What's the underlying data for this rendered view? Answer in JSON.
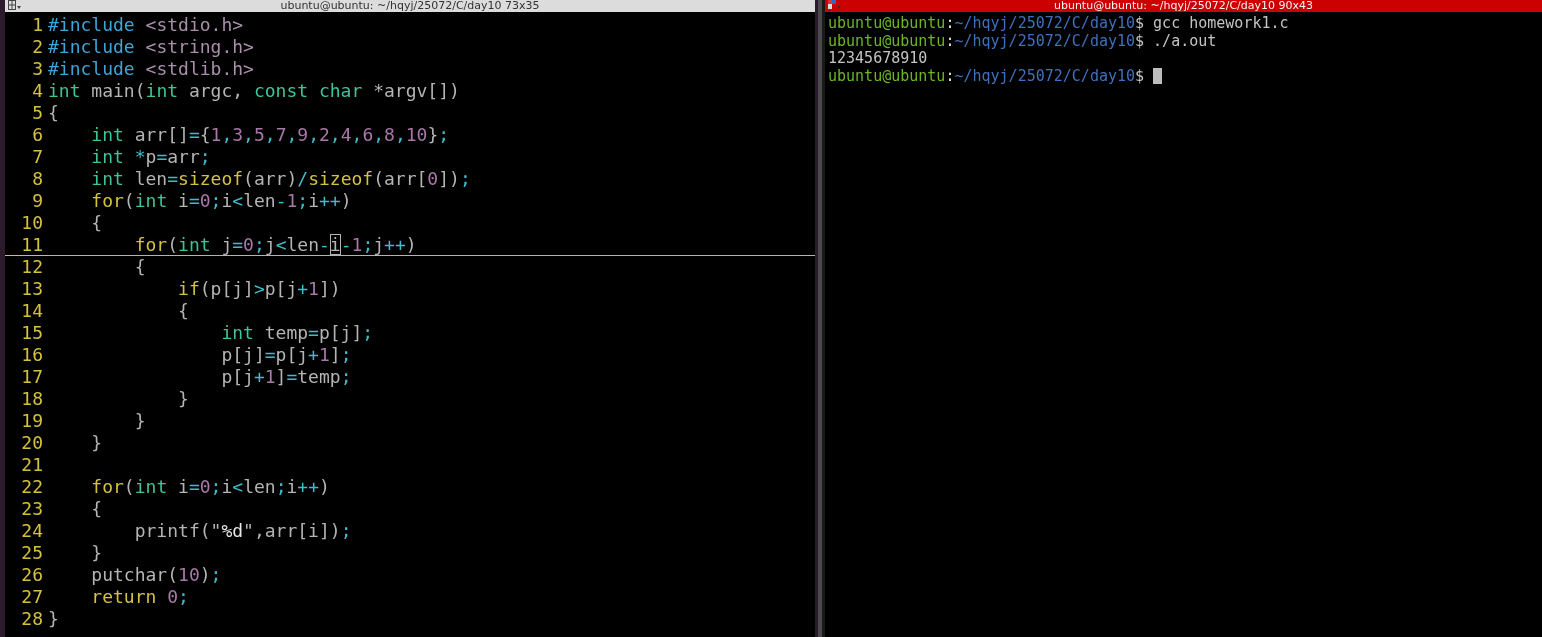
{
  "editor": {
    "title": "ubuntu@ubuntu: ~/hqyj/25072/C/day10 73x35",
    "lines": [
      {
        "number": "1",
        "current": false,
        "tokens": [
          {
            "kind": "pp",
            "text": "#include"
          },
          {
            "kind": "inc",
            "text": " <stdio.h>"
          }
        ]
      },
      {
        "number": "2",
        "current": false,
        "tokens": [
          {
            "kind": "pp",
            "text": "#include"
          },
          {
            "kind": "inc",
            "text": " <string.h>"
          }
        ]
      },
      {
        "number": "3",
        "current": false,
        "tokens": [
          {
            "kind": "pp",
            "text": "#include"
          },
          {
            "kind": "inc",
            "text": " <stdlib.h>"
          }
        ]
      },
      {
        "number": "4",
        "current": false,
        "tokens": [
          {
            "kind": "type",
            "text": "int"
          },
          {
            "kind": "plain",
            "text": " main("
          },
          {
            "kind": "type",
            "text": "int"
          },
          {
            "kind": "plain",
            "text": " argc, "
          },
          {
            "kind": "type",
            "text": "const"
          },
          {
            "kind": "type",
            "text": " char"
          },
          {
            "kind": "plain",
            "text": " *argv[])"
          }
        ]
      },
      {
        "number": "5",
        "current": false,
        "tokens": [
          {
            "kind": "plain",
            "text": "{"
          }
        ]
      },
      {
        "number": "6",
        "current": false,
        "tokens": [
          {
            "kind": "type",
            "text": "    int"
          },
          {
            "kind": "plain",
            "text": " arr[]"
          },
          {
            "kind": "op",
            "text": "="
          },
          {
            "kind": "plain",
            "text": "{"
          },
          {
            "kind": "num",
            "text": "1"
          },
          {
            "kind": "op",
            "text": ","
          },
          {
            "kind": "num",
            "text": "3"
          },
          {
            "kind": "op",
            "text": ","
          },
          {
            "kind": "num",
            "text": "5"
          },
          {
            "kind": "op",
            "text": ","
          },
          {
            "kind": "num",
            "text": "7"
          },
          {
            "kind": "op",
            "text": ","
          },
          {
            "kind": "num",
            "text": "9"
          },
          {
            "kind": "op",
            "text": ","
          },
          {
            "kind": "num",
            "text": "2"
          },
          {
            "kind": "op",
            "text": ","
          },
          {
            "kind": "num",
            "text": "4"
          },
          {
            "kind": "op",
            "text": ","
          },
          {
            "kind": "num",
            "text": "6"
          },
          {
            "kind": "op",
            "text": ","
          },
          {
            "kind": "num",
            "text": "8"
          },
          {
            "kind": "op",
            "text": ","
          },
          {
            "kind": "num",
            "text": "10"
          },
          {
            "kind": "plain",
            "text": "}"
          },
          {
            "kind": "op",
            "text": ";"
          }
        ]
      },
      {
        "number": "7",
        "current": false,
        "tokens": [
          {
            "kind": "type",
            "text": "    int"
          },
          {
            "kind": "op",
            "text": " *"
          },
          {
            "kind": "plain",
            "text": "p"
          },
          {
            "kind": "op",
            "text": "="
          },
          {
            "kind": "plain",
            "text": "arr"
          },
          {
            "kind": "op",
            "text": ";"
          }
        ]
      },
      {
        "number": "8",
        "current": false,
        "tokens": [
          {
            "kind": "type",
            "text": "    int"
          },
          {
            "kind": "plain",
            "text": " len"
          },
          {
            "kind": "op",
            "text": "="
          },
          {
            "kind": "stmt",
            "text": "sizeof"
          },
          {
            "kind": "plain",
            "text": "(arr)"
          },
          {
            "kind": "op",
            "text": "/"
          },
          {
            "kind": "stmt",
            "text": "sizeof"
          },
          {
            "kind": "plain",
            "text": "(arr["
          },
          {
            "kind": "num",
            "text": "0"
          },
          {
            "kind": "plain",
            "text": "])"
          },
          {
            "kind": "op",
            "text": ";"
          }
        ]
      },
      {
        "number": "9",
        "current": false,
        "tokens": [
          {
            "kind": "stmt",
            "text": "    for"
          },
          {
            "kind": "plain",
            "text": "("
          },
          {
            "kind": "type",
            "text": "int"
          },
          {
            "kind": "plain",
            "text": " i"
          },
          {
            "kind": "op",
            "text": "="
          },
          {
            "kind": "num",
            "text": "0"
          },
          {
            "kind": "op",
            "text": ";"
          },
          {
            "kind": "plain",
            "text": "i"
          },
          {
            "kind": "op",
            "text": "<"
          },
          {
            "kind": "plain",
            "text": "len"
          },
          {
            "kind": "op",
            "text": "-"
          },
          {
            "kind": "num",
            "text": "1"
          },
          {
            "kind": "op",
            "text": ";"
          },
          {
            "kind": "plain",
            "text": "i"
          },
          {
            "kind": "op",
            "text": "++"
          },
          {
            "kind": "plain",
            "text": ")"
          }
        ]
      },
      {
        "number": "10",
        "current": false,
        "tokens": [
          {
            "kind": "plain",
            "text": "    {"
          }
        ]
      },
      {
        "number": "11",
        "current": true,
        "tokens": [
          {
            "kind": "stmt",
            "text": "        for"
          },
          {
            "kind": "plain",
            "text": "("
          },
          {
            "kind": "type",
            "text": "int"
          },
          {
            "kind": "plain",
            "text": " j"
          },
          {
            "kind": "op",
            "text": "="
          },
          {
            "kind": "num",
            "text": "0"
          },
          {
            "kind": "op",
            "text": ";"
          },
          {
            "kind": "plain",
            "text": "j"
          },
          {
            "kind": "op",
            "text": "<"
          },
          {
            "kind": "plain",
            "text": "len"
          },
          {
            "kind": "op",
            "text": "-"
          },
          {
            "kind": "cursor",
            "text": "i"
          },
          {
            "kind": "op",
            "text": "-"
          },
          {
            "kind": "num",
            "text": "1"
          },
          {
            "kind": "op",
            "text": ";"
          },
          {
            "kind": "plain",
            "text": "j"
          },
          {
            "kind": "op",
            "text": "++"
          },
          {
            "kind": "plain",
            "text": ")"
          }
        ]
      },
      {
        "number": "12",
        "current": false,
        "tokens": [
          {
            "kind": "plain",
            "text": "        {"
          }
        ]
      },
      {
        "number": "13",
        "current": false,
        "tokens": [
          {
            "kind": "stmt",
            "text": "            if"
          },
          {
            "kind": "plain",
            "text": "(p[j]"
          },
          {
            "kind": "op",
            "text": ">"
          },
          {
            "kind": "plain",
            "text": "p[j"
          },
          {
            "kind": "op",
            "text": "+"
          },
          {
            "kind": "num",
            "text": "1"
          },
          {
            "kind": "plain",
            "text": "])"
          }
        ]
      },
      {
        "number": "14",
        "current": false,
        "tokens": [
          {
            "kind": "plain",
            "text": "            {"
          }
        ]
      },
      {
        "number": "15",
        "current": false,
        "tokens": [
          {
            "kind": "type",
            "text": "                int"
          },
          {
            "kind": "plain",
            "text": " temp"
          },
          {
            "kind": "op",
            "text": "="
          },
          {
            "kind": "plain",
            "text": "p[j]"
          },
          {
            "kind": "op",
            "text": ";"
          }
        ]
      },
      {
        "number": "16",
        "current": false,
        "tokens": [
          {
            "kind": "plain",
            "text": "                p[j]"
          },
          {
            "kind": "op",
            "text": "="
          },
          {
            "kind": "plain",
            "text": "p[j"
          },
          {
            "kind": "op",
            "text": "+"
          },
          {
            "kind": "num",
            "text": "1"
          },
          {
            "kind": "plain",
            "text": "]"
          },
          {
            "kind": "op",
            "text": ";"
          }
        ]
      },
      {
        "number": "17",
        "current": false,
        "tokens": [
          {
            "kind": "plain",
            "text": "                p[j"
          },
          {
            "kind": "op",
            "text": "+"
          },
          {
            "kind": "num",
            "text": "1"
          },
          {
            "kind": "plain",
            "text": "]"
          },
          {
            "kind": "op",
            "text": "="
          },
          {
            "kind": "plain",
            "text": "temp"
          },
          {
            "kind": "op",
            "text": ";"
          }
        ]
      },
      {
        "number": "18",
        "current": false,
        "tokens": [
          {
            "kind": "plain",
            "text": "            }"
          }
        ]
      },
      {
        "number": "19",
        "current": false,
        "tokens": [
          {
            "kind": "plain",
            "text": "        }"
          }
        ]
      },
      {
        "number": "20",
        "current": false,
        "tokens": [
          {
            "kind": "plain",
            "text": "    }"
          }
        ]
      },
      {
        "number": "21",
        "current": false
      },
      {
        "number": "22",
        "current": false,
        "tokens": [
          {
            "kind": "stmt",
            "text": "    for"
          },
          {
            "kind": "plain",
            "text": "("
          },
          {
            "kind": "type",
            "text": "int"
          },
          {
            "kind": "plain",
            "text": " i"
          },
          {
            "kind": "op",
            "text": "="
          },
          {
            "kind": "num",
            "text": "0"
          },
          {
            "kind": "op",
            "text": ";"
          },
          {
            "kind": "plain",
            "text": "i"
          },
          {
            "kind": "op",
            "text": "<"
          },
          {
            "kind": "plain",
            "text": "len"
          },
          {
            "kind": "op",
            "text": ";"
          },
          {
            "kind": "plain",
            "text": "i"
          },
          {
            "kind": "op",
            "text": "++"
          },
          {
            "kind": "plain",
            "text": ")"
          }
        ]
      },
      {
        "number": "23",
        "current": false,
        "tokens": [
          {
            "kind": "plain",
            "text": "    {"
          }
        ]
      },
      {
        "number": "24",
        "current": false,
        "tokens": [
          {
            "kind": "plain",
            "text": "        printf(\""
          },
          {
            "kind": "special",
            "text": "%d"
          },
          {
            "kind": "plain",
            "text": "\",arr[i])"
          },
          {
            "kind": "op",
            "text": ";"
          }
        ]
      },
      {
        "number": "25",
        "current": false,
        "tokens": [
          {
            "kind": "plain",
            "text": "    }"
          }
        ]
      },
      {
        "number": "26",
        "current": false,
        "tokens": [
          {
            "kind": "plain",
            "text": "    putchar("
          },
          {
            "kind": "num",
            "text": "10"
          },
          {
            "kind": "plain",
            "text": ")"
          },
          {
            "kind": "op",
            "text": ";"
          }
        ]
      },
      {
        "number": "27",
        "current": false,
        "tokens": [
          {
            "kind": "stmt",
            "text": "    return"
          },
          {
            "kind": "num",
            "text": " 0"
          },
          {
            "kind": "op",
            "text": ";"
          }
        ]
      },
      {
        "number": "28",
        "current": false,
        "tokens": [
          {
            "kind": "plain",
            "text": "}"
          }
        ]
      }
    ]
  },
  "terminal": {
    "title": "ubuntu@ubuntu: ~/hqyj/25072/C/day10 90x43",
    "lines": [
      {
        "kind": "prompt",
        "user_host": "ubuntu@ubuntu",
        "sep": ":",
        "path": "~/hqyj/25072/C/day10",
        "symbol": "$",
        "command": "gcc homework1.c",
        "cursor": false
      },
      {
        "kind": "prompt",
        "user_host": "ubuntu@ubuntu",
        "sep": ":",
        "path": "~/hqyj/25072/C/day10",
        "symbol": "$",
        "command": "./a.out",
        "cursor": false
      },
      {
        "kind": "output",
        "text": "12345678910"
      },
      {
        "kind": "prompt",
        "user_host": "ubuntu@ubuntu",
        "sep": ":",
        "path": "~/hqyj/25072/C/day10",
        "symbol": "$",
        "cursor": true
      }
    ]
  }
}
